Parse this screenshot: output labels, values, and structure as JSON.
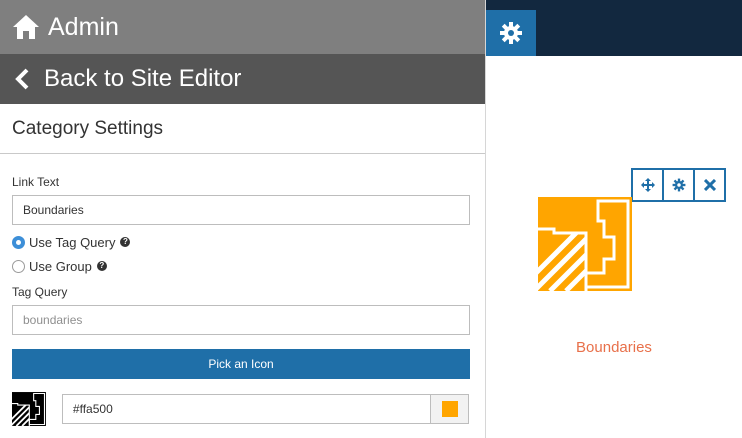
{
  "admin": {
    "title": "Admin",
    "icon": "home-icon"
  },
  "back": {
    "label": "Back to Site Editor",
    "icon": "chevron-left-icon"
  },
  "section": {
    "title": "Category Settings"
  },
  "form": {
    "link_text": {
      "label": "Link Text",
      "value": "Boundaries"
    },
    "radios": [
      {
        "label": "Use Tag Query",
        "checked": true
      },
      {
        "label": "Use Group",
        "checked": false
      }
    ],
    "tag_query": {
      "label": "Tag Query",
      "placeholder": "boundaries"
    },
    "pick_icon_label": "Pick an Icon",
    "color": {
      "value": "#ffa500"
    }
  },
  "preview": {
    "category_label": "Boundaries",
    "icon_color": "#ffa500",
    "label_color": "#e8704a",
    "tools": [
      "move-icon",
      "gear-icon",
      "close-icon"
    ]
  },
  "colors": {
    "accent": "#1f6fa8",
    "topbar": "#12283f",
    "admin_bar": "#7f7f7f",
    "back_bar": "#555555"
  }
}
